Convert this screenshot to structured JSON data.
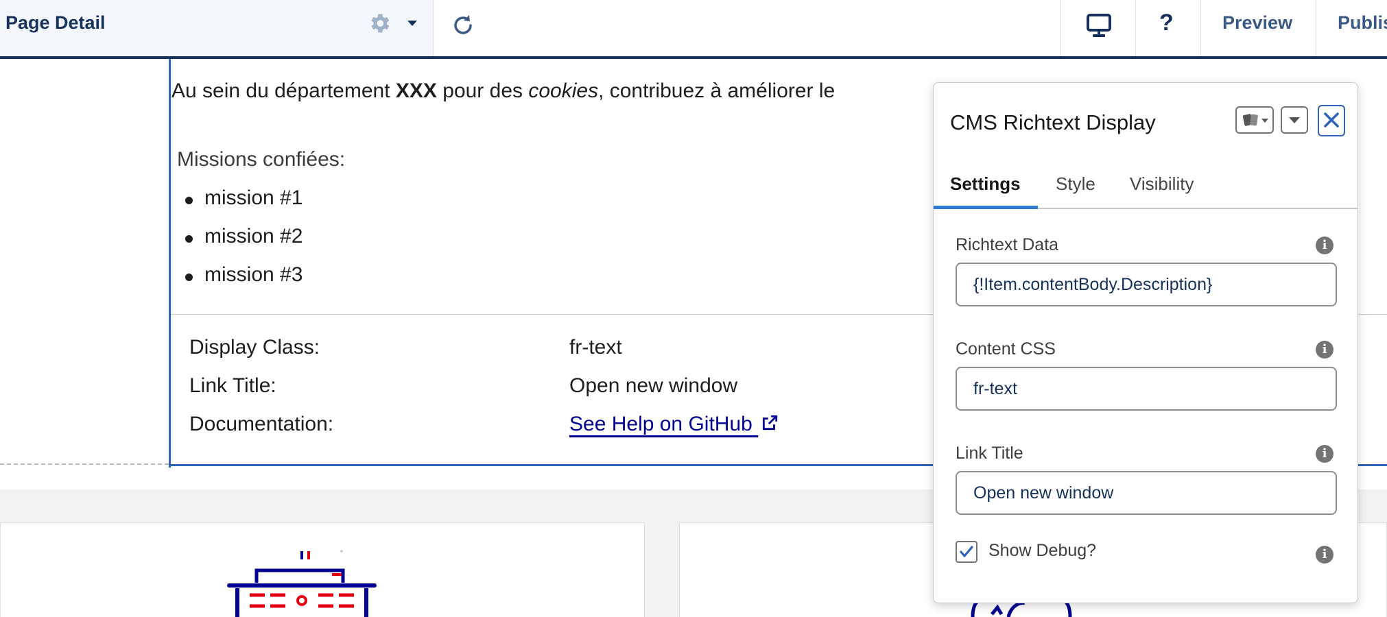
{
  "toolbar": {
    "page_title": "Page Detail",
    "setup_icon": "gear-icon",
    "setup_menu_icon": "chevron-down-icon",
    "refresh_icon": "refresh-icon",
    "device_icon": "desktop-icon",
    "help_label": "?",
    "preview_label": "Preview",
    "publish_label": "Publis"
  },
  "content": {
    "intro": {
      "prefix": "Au sein du département ",
      "bold": "XXX",
      "mid": " pour des ",
      "italic": "cookies",
      "suffix": ", contribuez à améliorer le"
    },
    "missions_title": "Missions confiées:",
    "missions": [
      "mission #1",
      "mission #2",
      "mission #3"
    ],
    "debug": {
      "display_class_label": "Display Class:",
      "display_class_value": "fr-text",
      "link_title_label": "Link Title:",
      "link_title_value": "Open new window",
      "documentation_label": "Documentation:",
      "documentation_link": "See Help on GitHub"
    }
  },
  "panel": {
    "title": "CMS Richtext Display",
    "tabs": [
      "Settings",
      "Style",
      "Visibility"
    ],
    "active_tab": "Settings",
    "fields": [
      {
        "label": "Richtext Data",
        "value": "{!Item.contentBody.Description}"
      },
      {
        "label": "Content CSS",
        "value": "fr-text"
      },
      {
        "label": "Link Title",
        "value": "Open new window"
      }
    ],
    "show_debug_label": "Show Debug?",
    "show_debug_checked": true
  },
  "colors": {
    "brand_navy": "#16325c",
    "accent_blue": "#2e63b7",
    "tab_underline": "#2e7bd8",
    "link_blue": "#000091",
    "dsfr_red": "#e1000f"
  }
}
